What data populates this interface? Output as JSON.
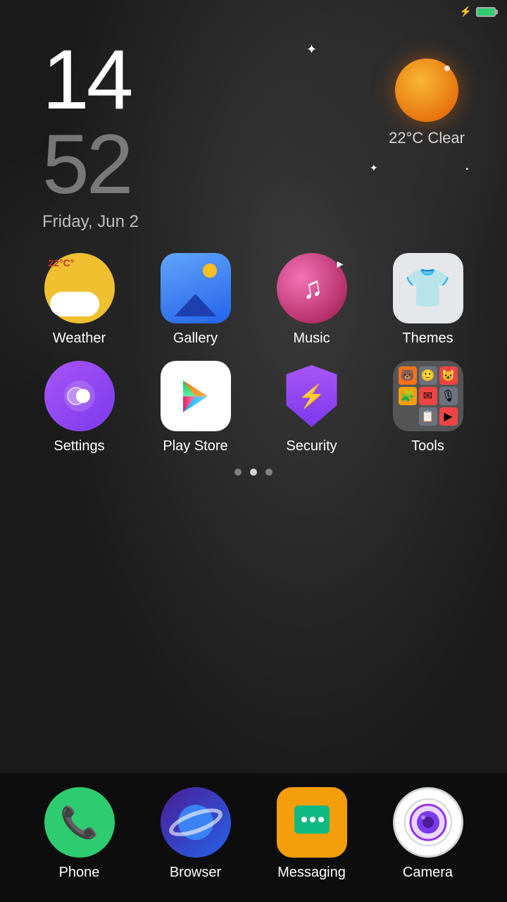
{
  "statusBar": {
    "batteryIcon": "⚡",
    "batteryColor": "#2ecc71"
  },
  "clock": {
    "hour": "14",
    "minute": "52",
    "date": "Friday, Jun 2"
  },
  "weather": {
    "temp": "22°C",
    "condition": "Clear",
    "display": "22°C Clear"
  },
  "stars": [
    {
      "id": "star1",
      "char": "✦"
    },
    {
      "id": "star2",
      "char": "✦"
    },
    {
      "id": "star3",
      "char": "•"
    }
  ],
  "apps": [
    {
      "row": 1,
      "items": [
        {
          "id": "weather",
          "label": "Weather",
          "tempBadge": "22°C"
        },
        {
          "id": "gallery",
          "label": "Gallery"
        },
        {
          "id": "music",
          "label": "Music"
        },
        {
          "id": "themes",
          "label": "Themes"
        }
      ]
    },
    {
      "row": 2,
      "items": [
        {
          "id": "settings",
          "label": "Settings"
        },
        {
          "id": "playstore",
          "label": "Play Store"
        },
        {
          "id": "security",
          "label": "Security"
        },
        {
          "id": "tools",
          "label": "Tools"
        }
      ]
    }
  ],
  "pageIndicator": {
    "dots": [
      {
        "active": false
      },
      {
        "active": true
      },
      {
        "active": false
      }
    ]
  },
  "dock": [
    {
      "id": "phone",
      "label": "Phone"
    },
    {
      "id": "browser",
      "label": "Browser"
    },
    {
      "id": "messaging",
      "label": "Messaging"
    },
    {
      "id": "camera",
      "label": "Camera"
    }
  ]
}
